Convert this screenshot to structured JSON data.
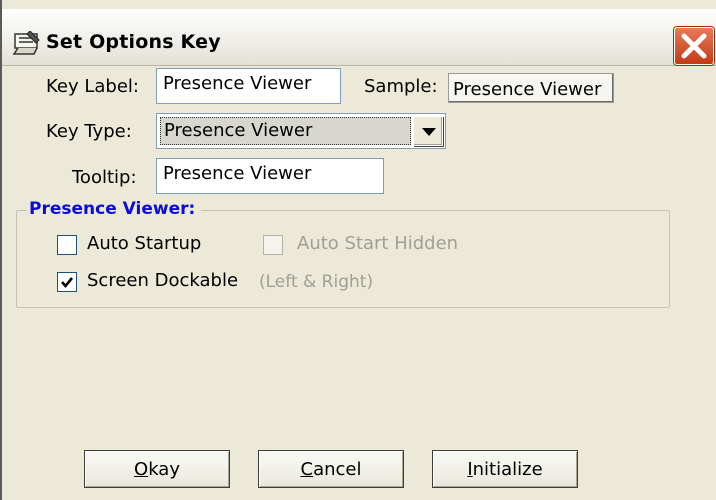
{
  "window": {
    "title": "Set Options Key"
  },
  "form": {
    "key_label": {
      "label": "Key Label:",
      "value": "Presence Viewer"
    },
    "sample": {
      "label": "Sample:",
      "value": "Presence Viewer"
    },
    "key_type": {
      "label": "Key Type:",
      "value": "Presence Viewer"
    },
    "tooltip": {
      "label": "Tooltip:",
      "value": "Presence Viewer"
    }
  },
  "group": {
    "title": "Presence Viewer:",
    "auto_startup": {
      "label": "Auto Startup",
      "checked": false
    },
    "auto_start_hidden": {
      "label": "Auto Start Hidden",
      "checked": false,
      "enabled": false
    },
    "screen_dockable": {
      "label": "Screen Dockable",
      "checked": true,
      "hint": "(Left & Right)"
    }
  },
  "buttons": {
    "okay": {
      "mnemonic": "O",
      "rest": "kay"
    },
    "cancel": {
      "mnemonic": "C",
      "rest": "ancel"
    },
    "initialize": {
      "mnemonic": "I",
      "rest": "nitialize"
    }
  },
  "icons": [
    "key-icon",
    "close-icon",
    "dropdown-arrow-icon",
    "checkmark-icon"
  ]
}
